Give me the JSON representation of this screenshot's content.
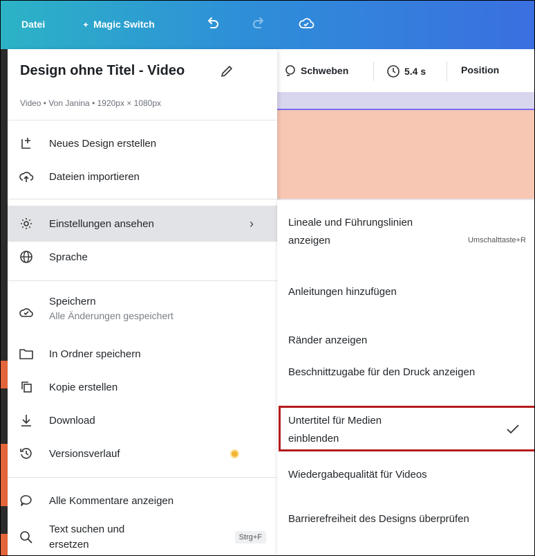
{
  "topbar": {
    "file_label": "Datei",
    "magic_switch_label": "Magic Switch",
    "icons": {
      "undo": "undo-icon",
      "redo": "redo-icon",
      "cloud": "cloud-saved-icon"
    }
  },
  "toolbar": {
    "float_label": "Schweben",
    "duration_label": "5.4 s",
    "position_label": "Position"
  },
  "file_menu": {
    "title": "Design ohne Titel - Video",
    "subtitle": "Video • Von Janina • 1920px × 1080px",
    "items": {
      "new_design": "Neues Design erstellen",
      "import_files": "Dateien importieren",
      "view_settings": "Einstellungen ansehen",
      "language": "Sprache",
      "save": "Speichern",
      "save_status": "Alle Änderungen gespeichert",
      "save_to_folder": "In Ordner speichern",
      "make_copy": "Kopie erstellen",
      "download": "Download",
      "version_history": "Versionsverlauf",
      "show_comments": "Alle Kommentare anzeigen",
      "find_replace": "Text suchen und ersetzen",
      "find_replace_shortcut": "Strg+F"
    }
  },
  "settings_submenu": {
    "rulers": "Lineale und Führungslinien anzeigen",
    "rulers_shortcut": "Umschalttaste+R",
    "add_guides": "Anleitungen hinzufügen",
    "show_margins": "Ränder anzeigen",
    "print_bleed": "Beschnittzugabe für den Druck anzeigen",
    "captions": "Untertitel für Medien einblenden",
    "playback_quality": "Wiedergabequalität für Videos",
    "accessibility": "Barrierefreiheit des Designs überprüfen"
  },
  "colors": {
    "topbar_start": "#2cb3c6",
    "topbar_end": "#3a6fe0",
    "highlight_box": "#b51c1c",
    "hover_row": "#e2e3e6",
    "canvas_peach": "#f8c7b3"
  }
}
